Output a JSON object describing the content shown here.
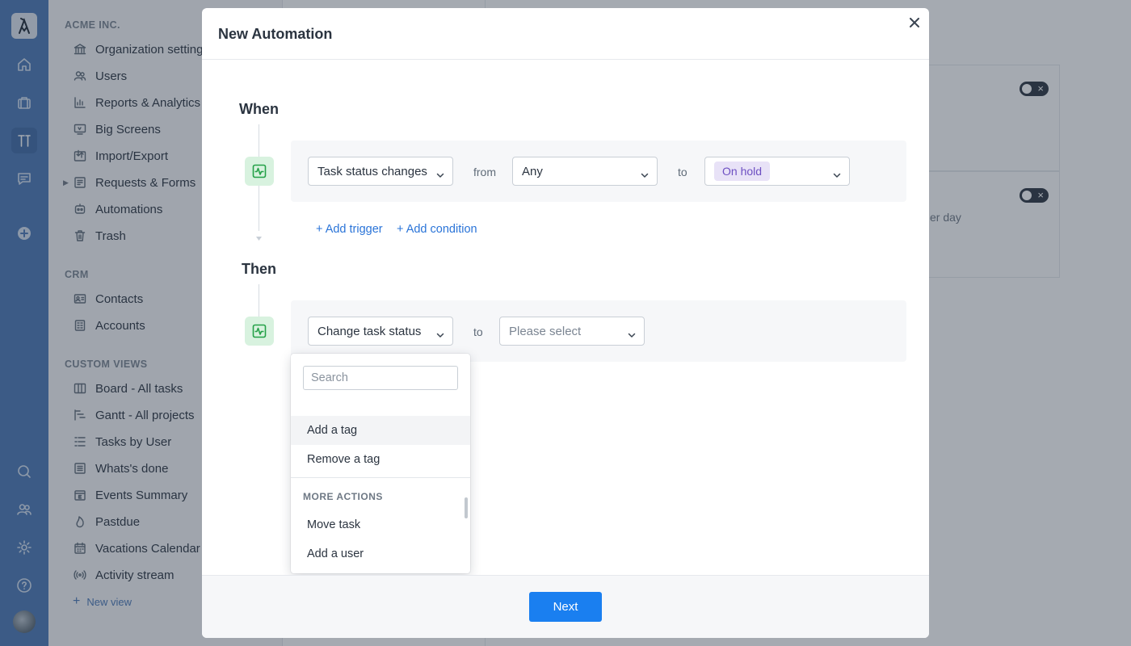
{
  "sidebar": {
    "sections": [
      {
        "title": "ACME INC."
      },
      {
        "title": "CRM"
      },
      {
        "title": "CUSTOM VIEWS"
      }
    ],
    "org_items": [
      {
        "label": "Organization settings",
        "icon": "bank-icon"
      },
      {
        "label": "Users",
        "icon": "users-icon"
      },
      {
        "label": "Reports & Analytics",
        "icon": "chart-icon"
      },
      {
        "label": "Big Screens",
        "icon": "tv-icon"
      },
      {
        "label": "Import/Export",
        "icon": "import-export-icon"
      },
      {
        "label": "Requests & Forms",
        "icon": "form-icon"
      },
      {
        "label": "Automations",
        "icon": "robot-icon"
      },
      {
        "label": "Trash",
        "icon": "trash-icon"
      }
    ],
    "crm_items": [
      {
        "label": "Contacts",
        "icon": "contact-card-icon"
      },
      {
        "label": "Accounts",
        "icon": "building-icon"
      }
    ],
    "view_items": [
      {
        "label": "Board - All tasks",
        "icon": "board-icon"
      },
      {
        "label": "Gantt - All projects",
        "icon": "gantt-icon"
      },
      {
        "label": "Tasks by User",
        "icon": "list-icon"
      },
      {
        "label": "Whats's done",
        "icon": "done-list-icon"
      },
      {
        "label": "Events Summary",
        "icon": "calendar-e-icon"
      },
      {
        "label": "Pastdue",
        "icon": "fire-icon"
      },
      {
        "label": "Vacations Calendar",
        "icon": "calendar-icon"
      },
      {
        "label": "Activity stream",
        "icon": "broadcast-icon"
      }
    ],
    "new_view": "New view"
  },
  "background": {
    "card_text": "er day"
  },
  "modal": {
    "title": "New Automation",
    "when": {
      "label": "When",
      "trigger_select": "Task status changes",
      "from_label": "from",
      "from_select": "Any",
      "to_label": "to",
      "to_tag": "On hold",
      "add_trigger": "+ Add trigger",
      "add_condition": "+ Add condition"
    },
    "then": {
      "label": "Then",
      "action_select": "Change task status",
      "to_label": "to",
      "to_placeholder": "Please select"
    },
    "dropdown": {
      "search_placeholder": "Search",
      "items": [
        "Add a tag",
        "Remove a tag"
      ],
      "group_label": "MORE ACTIONS",
      "group_items": [
        "Move task",
        "Add a user"
      ]
    },
    "next_button": "Next"
  },
  "colors": {
    "rail": "#4a78b6",
    "primary_button": "#1a7ff0",
    "link": "#2a74d8",
    "tag_bg": "#e8e2f7",
    "tag_text": "#6d4fc2",
    "step_icon": "#24a148"
  }
}
